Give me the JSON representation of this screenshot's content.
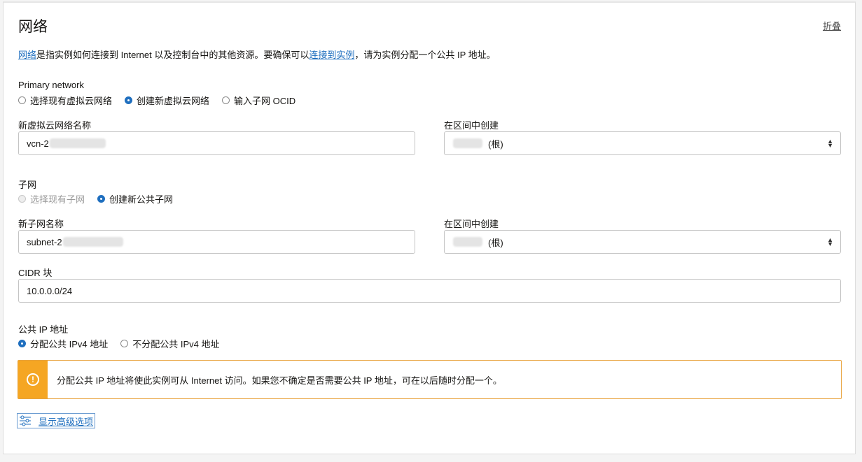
{
  "section": {
    "title": "网络",
    "collapse_label": "折叠",
    "desc_link1": "网络",
    "desc_text1": "是指实例如何连接到 Internet 以及控制台中的其他资源。要确保可以",
    "desc_link2": "连接到实例",
    "desc_text2": "，请为实例分配一个公共 IP 地址。"
  },
  "primary_network": {
    "label": "Primary network",
    "options": [
      "选择现有虚拟云网络",
      "创建新虚拟云网络",
      "输入子网 OCID"
    ],
    "selected": "创建新虚拟云网络"
  },
  "vcn": {
    "name_label": "新虚拟云网络名称",
    "name_value": "vcn-2",
    "compartment_label": "在区间中创建",
    "compartment_suffix": "(根)"
  },
  "subnet": {
    "label": "子网",
    "options": [
      "选择现有子网",
      "创建新公共子网"
    ],
    "selected": "创建新公共子网",
    "name_label": "新子网名称",
    "name_value": "subnet-2",
    "compartment_label": "在区间中创建",
    "compartment_suffix": "(根)",
    "cidr_label": "CIDR 块",
    "cidr_value": "10.0.0.0/24"
  },
  "public_ip": {
    "label": "公共 IP 地址",
    "options": [
      "分配公共 IPv4 地址",
      "不分配公共 IPv4 地址"
    ],
    "selected": "分配公共 IPv4 地址"
  },
  "alert": {
    "icon": "warning-icon",
    "message": "分配公共 IP 地址将使此实例可从 Internet 访问。如果您不确定是否需要公共 IP 地址，可在以后随时分配一个。"
  },
  "advanced": {
    "icon": "sliders-icon",
    "label": "显示高级选项"
  },
  "colors": {
    "link": "#1f6fbf",
    "warning": "#f5a623",
    "radio_selected": "#1f6fbf"
  }
}
